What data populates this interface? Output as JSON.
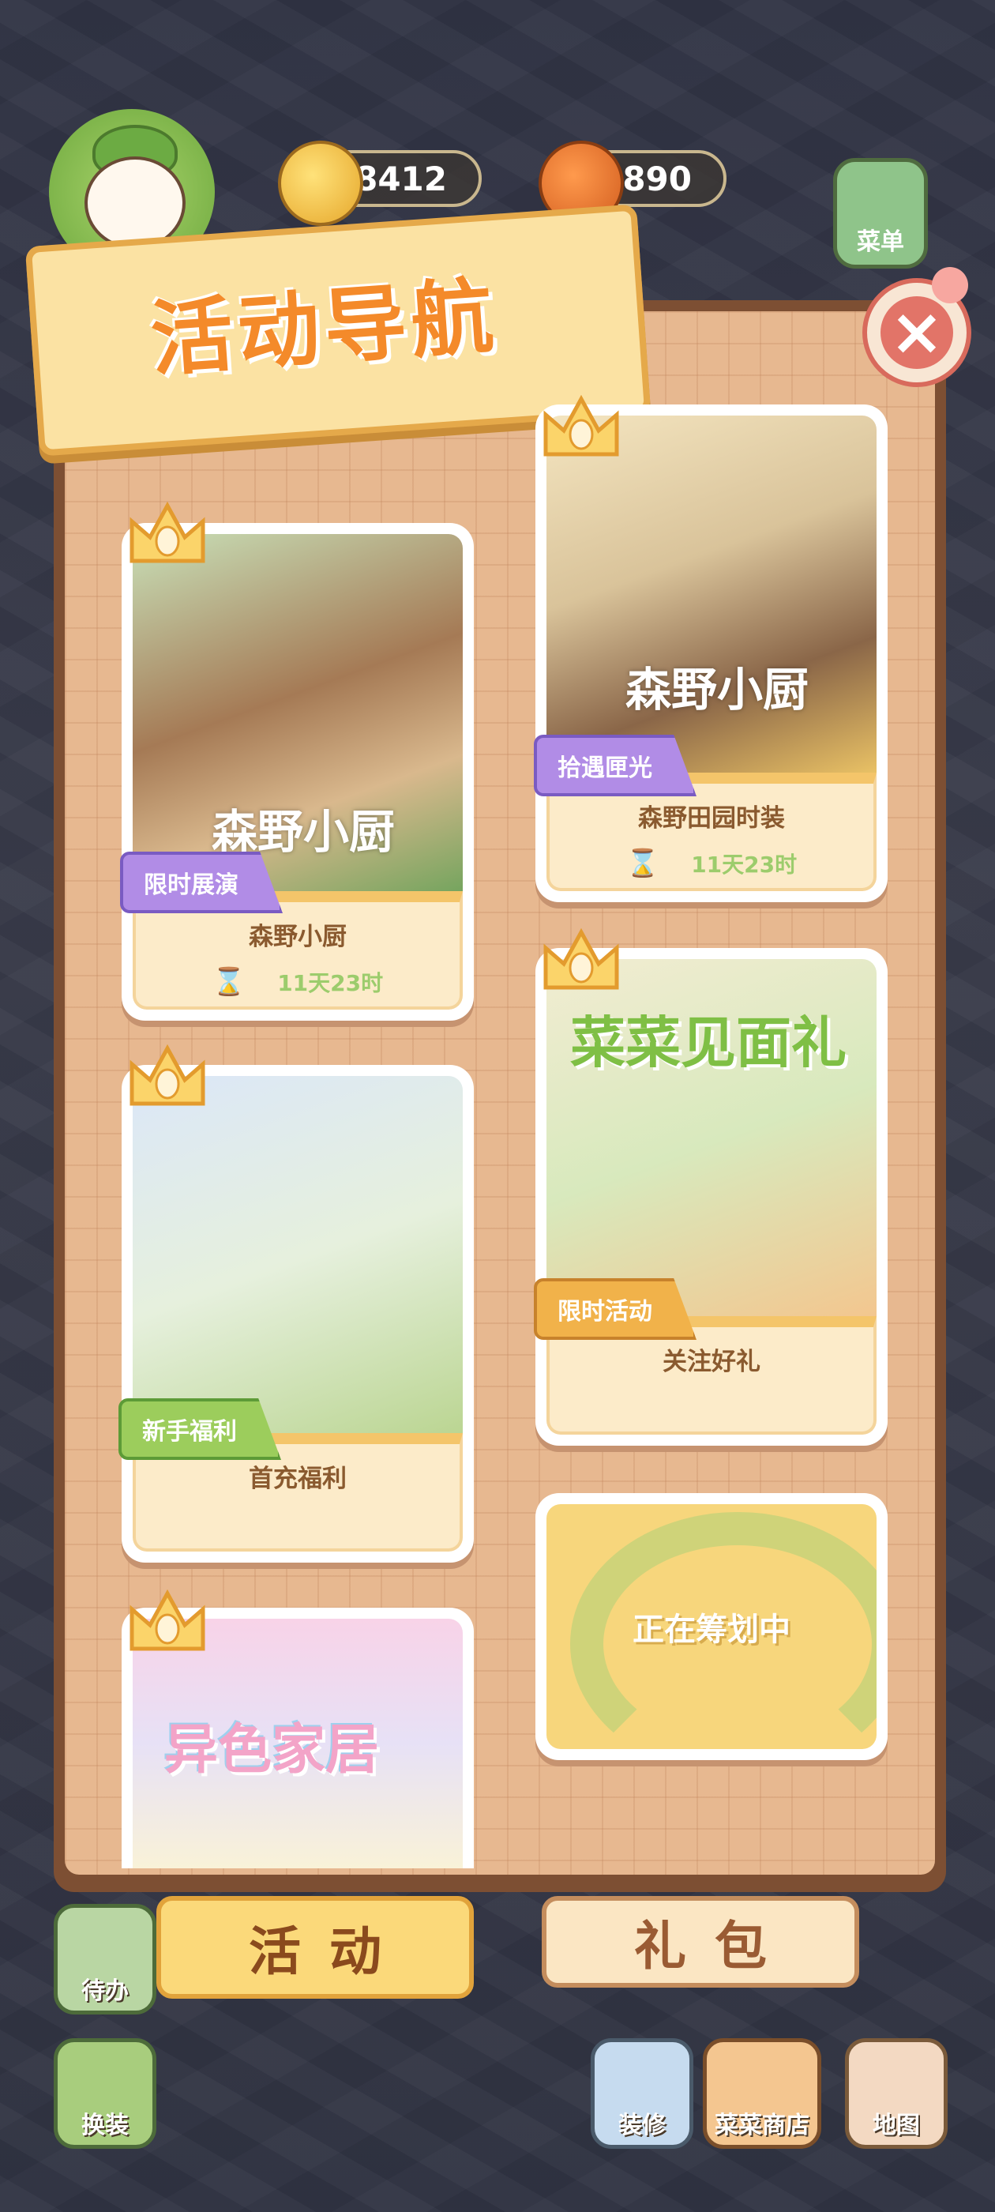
{
  "hud": {
    "coins": "8412",
    "carrots": "5890",
    "menu_label": "菜单"
  },
  "panel": {
    "title": "活动导航"
  },
  "cards": [
    {
      "name": "森野小厨",
      "timer": "11天23时",
      "tag": "限时展演",
      "art_title": "森野小厨"
    },
    {
      "name": "森野田园时装",
      "timer": "11天23时",
      "tag": "拾遇匣光",
      "art_title": "森野小厨"
    },
    {
      "name": "首充福利",
      "tag": "新手福利"
    },
    {
      "name": "关注好礼",
      "tag": "限时活动",
      "art_title": "菜菜见面礼"
    },
    {
      "name": "",
      "art_title": "异色家居"
    }
  ],
  "planning": {
    "label": "正在筹划中"
  },
  "tabs": [
    {
      "label": "活动"
    },
    {
      "label": "礼包"
    }
  ],
  "bottom_buttons": {
    "todo": "待办",
    "dress": "换装",
    "decorate": "装修",
    "shop": "菜菜商店",
    "map": "地图"
  },
  "colors": {
    "panel_bg": "#e7b890",
    "title": "#f48a2a",
    "tab_active": "#fbd97a"
  }
}
